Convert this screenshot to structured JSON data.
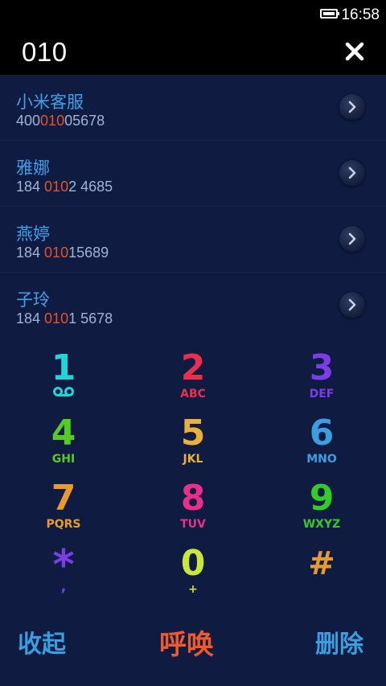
{
  "status_bar": {
    "time": "16:58"
  },
  "dialer": {
    "number": "010"
  },
  "contacts": [
    {
      "name": "小米客服",
      "phone_pre": "400",
      "phone_match": "010",
      "phone_post": "05678"
    },
    {
      "name": "雅娜",
      "phone_pre": "184 ",
      "phone_match": "010",
      "phone_post": "2 4685"
    },
    {
      "name": "燕婷",
      "phone_pre": "184 ",
      "phone_match": "010",
      "phone_post": "15689"
    },
    {
      "name": "子玲",
      "phone_pre": "184 ",
      "phone_match": "010",
      "phone_post": "1 5678"
    }
  ],
  "keypad": {
    "k1": {
      "digit": "1",
      "letters": ""
    },
    "k2": {
      "digit": "2",
      "letters": "ABC"
    },
    "k3": {
      "digit": "3",
      "letters": "DEF"
    },
    "k4": {
      "digit": "4",
      "letters": "GHI"
    },
    "k5": {
      "digit": "5",
      "letters": "JKL"
    },
    "k6": {
      "digit": "6",
      "letters": "MNO"
    },
    "k7": {
      "digit": "7",
      "letters": "PQRS"
    },
    "k8": {
      "digit": "8",
      "letters": "TUV"
    },
    "k9": {
      "digit": "9",
      "letters": "WXYZ"
    },
    "kstar": {
      "digit": "*",
      "letters": ","
    },
    "k0": {
      "digit": "0",
      "letters": "+"
    },
    "khash": {
      "digit": "#",
      "letters": ""
    }
  },
  "actions": {
    "collapse": "收起",
    "call": "呼唤",
    "delete": "删除"
  },
  "colors": {
    "background": "#0f1b40",
    "highlight": "#e5532b",
    "name": "#3fa0e8",
    "k1": "#22d3d8",
    "k2": "#e8304c",
    "k3": "#7b3ee6",
    "k4": "#55cc22",
    "k5": "#e8b13a",
    "k6": "#3a9ee0",
    "k7": "#e79b2d",
    "k8": "#e8308a",
    "k9": "#32cc2a",
    "kstar": "#7b3ee6",
    "k0": "#c9e63a",
    "khash": "#e79b2d",
    "collapse": "#3a9ee0",
    "call": "#f0592a",
    "delete": "#3a9ee0"
  }
}
